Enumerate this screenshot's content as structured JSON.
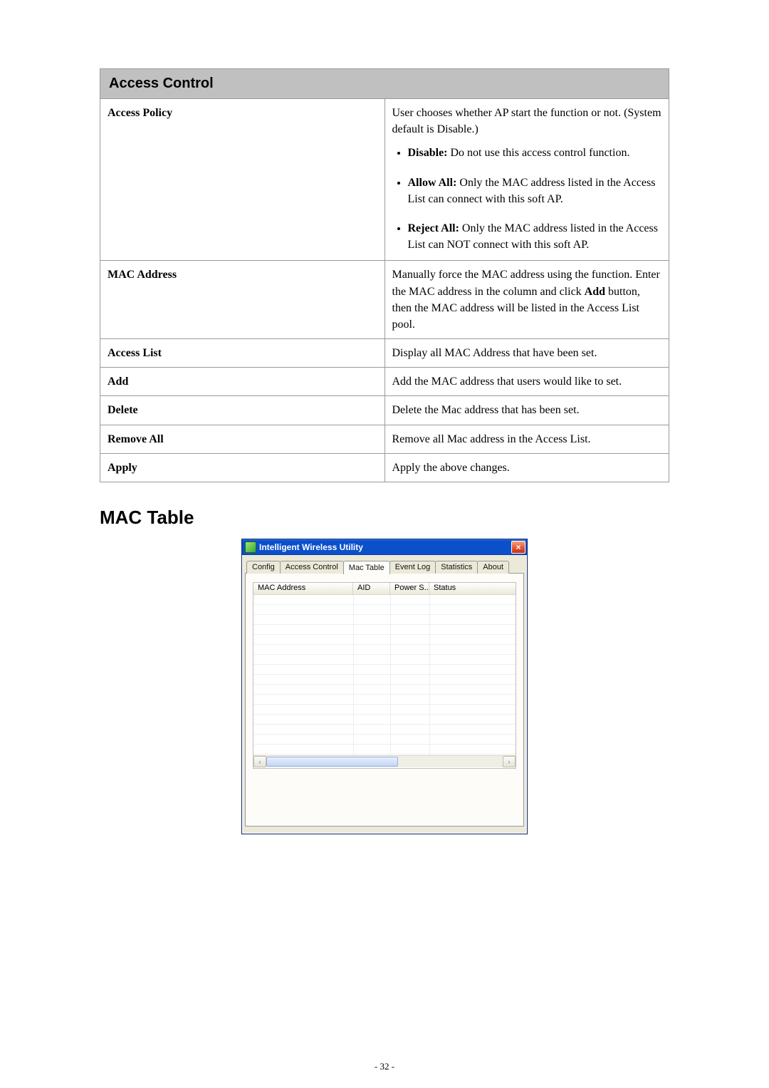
{
  "doc": {
    "section_header": "Access Control",
    "rows": {
      "access_policy": {
        "label": "Access Policy",
        "intro": "User chooses whether AP start the function or not. (System default is Disable.)",
        "opts": [
          {
            "name": "Disable:",
            "desc": "Do not use this access control function."
          },
          {
            "name": "Allow All:",
            "desc": "Only the MAC address listed in the Access List can connect with this soft AP."
          },
          {
            "name": "Reject All:",
            "desc": "Only the MAC address listed in the Access List can NOT connect with this soft AP."
          }
        ]
      },
      "mac_address": {
        "label": "MAC Address",
        "desc_pre": "Manually force the MAC address using the function. Enter the MAC address in the column and click ",
        "bold": "Add",
        "desc_post": " button, then the MAC address will be listed in the Access List pool."
      },
      "access_list": {
        "label": "Access List",
        "desc": "Display all MAC Address that have been set."
      },
      "add": {
        "label": "Add",
        "desc": "Add the MAC address that users would like to set."
      },
      "delete": {
        "label": "Delete",
        "desc": "Delete the Mac address that has been set."
      },
      "remove_all": {
        "label": "Remove All",
        "desc": "Remove all Mac address in the Access List."
      },
      "apply": {
        "label": "Apply",
        "desc": "Apply the above changes."
      }
    },
    "mac_table_heading": "MAC Table",
    "page_number": "- 32 -"
  },
  "dialog": {
    "title": "Intelligent Wireless Utility",
    "close_glyph": "×",
    "tabs": [
      "Config",
      "Access Control",
      "Mac Table",
      "Event Log",
      "Statistics",
      "About"
    ],
    "active_tab_index": 2,
    "columns": [
      "MAC Address",
      "AID",
      "Power S...",
      "Status"
    ],
    "hscroll": {
      "left_glyph": "‹",
      "right_glyph": "›",
      "thumb_left_pct": 0,
      "thumb_width_pct": 55
    }
  }
}
